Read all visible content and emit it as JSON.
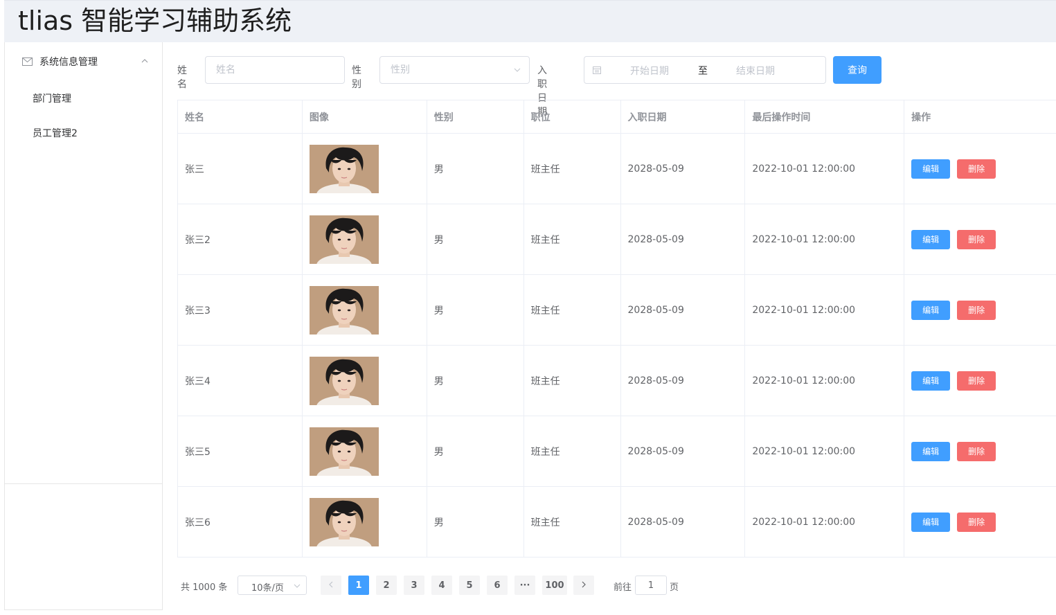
{
  "header": {
    "title": "tlias 智能学习辅助系统"
  },
  "sidebar": {
    "group": {
      "label": "系统信息管理",
      "icon": "mail-icon",
      "expanded": true
    },
    "items": [
      {
        "label": "部门管理"
      },
      {
        "label": "员工管理2"
      }
    ]
  },
  "search": {
    "name_label": "姓名",
    "name_placeholder": "姓名",
    "gender_label": "性别",
    "gender_placeholder": "性别",
    "date_label": "入职日期",
    "date_start_placeholder": "开始日期",
    "date_separator": "至",
    "date_end_placeholder": "结束日期",
    "query_label": "查询"
  },
  "table": {
    "headers": [
      "姓名",
      "图像",
      "性别",
      "职位",
      "入职日期",
      "最后操作时间",
      "操作"
    ],
    "rows": [
      {
        "name": "张三",
        "gender": "男",
        "position": "班主任",
        "entry_date": "2028-05-09",
        "update_time": "2022-10-01 12:00:00"
      },
      {
        "name": "张三2",
        "gender": "男",
        "position": "班主任",
        "entry_date": "2028-05-09",
        "update_time": "2022-10-01 12:00:00"
      },
      {
        "name": "张三3",
        "gender": "男",
        "position": "班主任",
        "entry_date": "2028-05-09",
        "update_time": "2022-10-01 12:00:00"
      },
      {
        "name": "张三4",
        "gender": "男",
        "position": "班主任",
        "entry_date": "2028-05-09",
        "update_time": "2022-10-01 12:00:00"
      },
      {
        "name": "张三5",
        "gender": "男",
        "position": "班主任",
        "entry_date": "2028-05-09",
        "update_time": "2022-10-01 12:00:00"
      },
      {
        "name": "张三6",
        "gender": "男",
        "position": "班主任",
        "entry_date": "2028-05-09",
        "update_time": "2022-10-01 12:00:00"
      }
    ],
    "edit_label": "编辑",
    "delete_label": "删除"
  },
  "pagination": {
    "total_text": "共 1000 条",
    "page_size": "10条/页",
    "pages": [
      "1",
      "2",
      "3",
      "4",
      "5",
      "6",
      "···",
      "100"
    ],
    "current_page": "1",
    "goto_label": "前往",
    "goto_value": "1",
    "page_suffix": "页"
  },
  "colors": {
    "primary": "#409eff",
    "danger": "#f56c6c",
    "header_bg": "#eef1f6"
  }
}
